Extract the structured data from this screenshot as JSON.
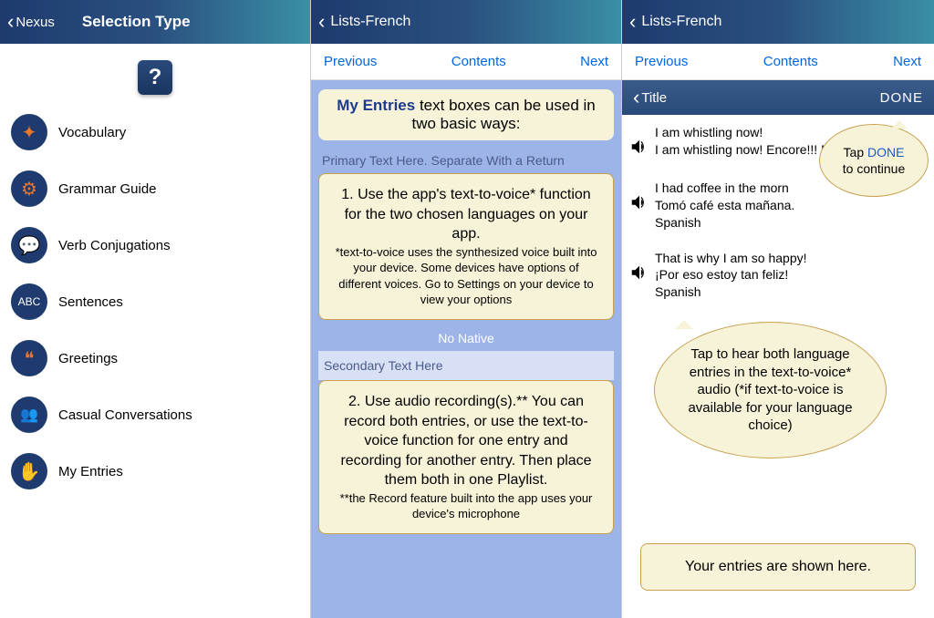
{
  "screen1": {
    "back": "Nexus",
    "title": "Selection Type",
    "help": "?",
    "items": [
      {
        "label": "Vocabulary"
      },
      {
        "label": "Grammar Guide"
      },
      {
        "label": "Verb Conjugations"
      },
      {
        "label": "Sentences"
      },
      {
        "label": "Greetings"
      },
      {
        "label": "Casual Conversations"
      },
      {
        "label": "My Entries"
      }
    ]
  },
  "screen2": {
    "back": "Lists-French",
    "nav": {
      "prev": "Previous",
      "contents": "Contents",
      "next": "Next"
    },
    "header_bold": "My Entries",
    "header_rest": " text boxes can be used in two basic ways:",
    "ph1": "Primary Text Here. Separate With a Return",
    "card1_main": "1. Use the app's text-to-voice* function for the two chosen languages on your app.",
    "card1_small": "*text-to-voice uses the synthesized voice built into your device. Some devices have options of different voices. Go to Settings on your device to view your options",
    "no_native": "No Native",
    "ph2": "Secondary Text Here",
    "card2_main": "2. Use audio recording(s).** You can record both entries, or use the text-to-voice function for one entry and recording for another entry. Then place them both in one Playlist.",
    "card2_small": "**the Record feature built into the app uses your device's microphone"
  },
  "screen3": {
    "back": "Lists-French",
    "nav": {
      "prev": "Previous",
      "contents": "Contents",
      "next": "Next"
    },
    "titlebar_back": "Title",
    "done": "DONE",
    "entries": [
      {
        "l1": "I am whistling now!",
        "l2": "I am whistling now! Encore!!! My Entries n",
        "l3": ""
      },
      {
        "l1": "I had coffee in the morn",
        "l2": "Tomó café esta mañana.",
        "l3": "Spanish"
      },
      {
        "l1": "That is why I am so happy!",
        "l2": "¡Por eso estoy tan feliz!",
        "l3": "Spanish"
      }
    ],
    "callout_done_1": "Tap ",
    "callout_done_word": "DONE",
    "callout_done_2": " to continue",
    "callout_hear": "Tap to hear both language entries in the text-to-voice* audio (*if text-to-voice is available for your language choice)",
    "callout_bottom": "Your entries are shown here."
  }
}
